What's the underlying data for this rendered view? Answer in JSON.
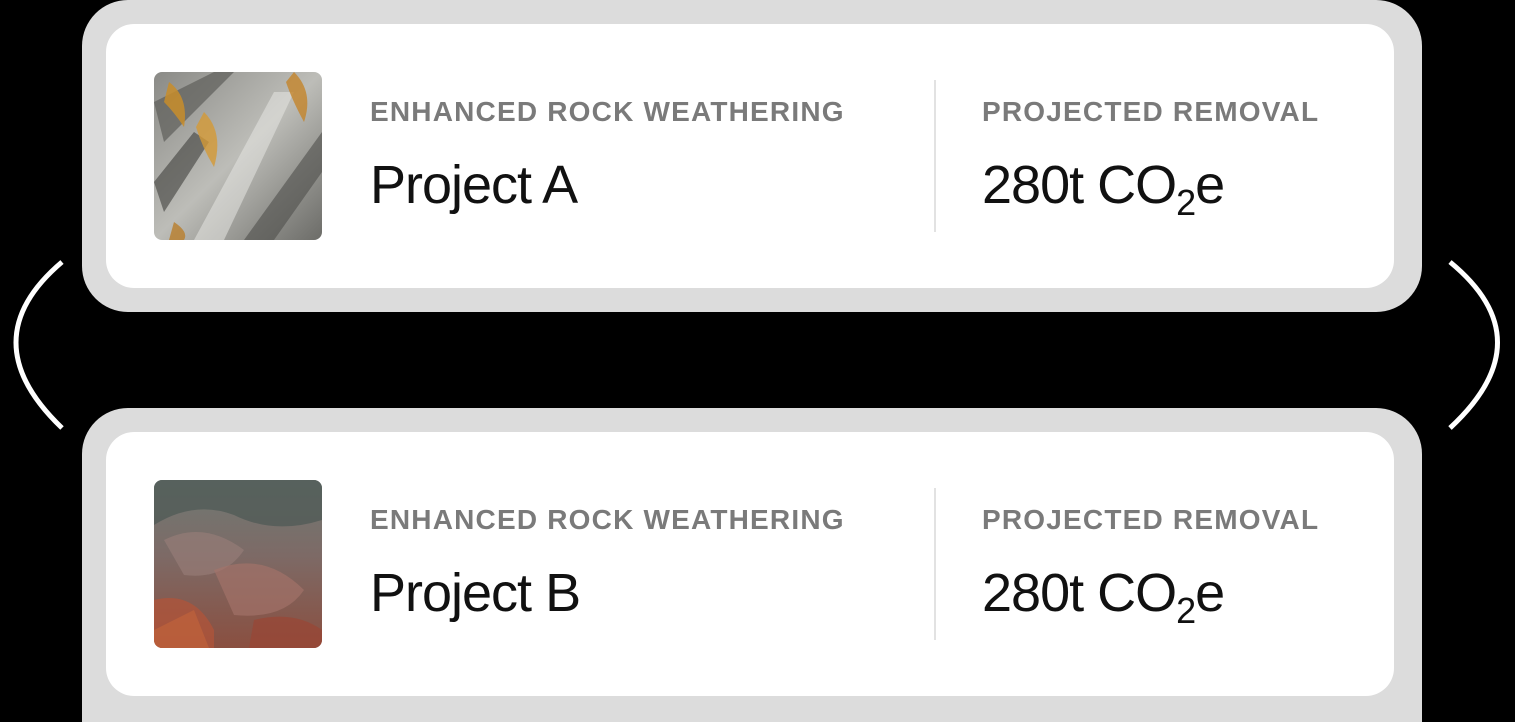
{
  "projects": [
    {
      "category": "ENHANCED ROCK WEATHERING",
      "name": "Project A",
      "removal_label": "PROJECTED REMOVAL",
      "removal_amount": "280t CO",
      "removal_subscript": "2",
      "removal_suffix": "e",
      "image": "grey-rock-with-orange-lichen-photo"
    },
    {
      "category": "ENHANCED ROCK WEATHERING",
      "name": "Project B",
      "removal_label": "PROJECTED REMOVAL",
      "removal_amount": "280t CO",
      "removal_subscript": "2",
      "removal_suffix": "e",
      "image": "reddish-rock-outcrop-photo"
    }
  ],
  "colors": {
    "background": "#000000",
    "frame": "#dcdcdc",
    "card": "#ffffff",
    "label": "#7a7a7a",
    "value": "#111111"
  }
}
